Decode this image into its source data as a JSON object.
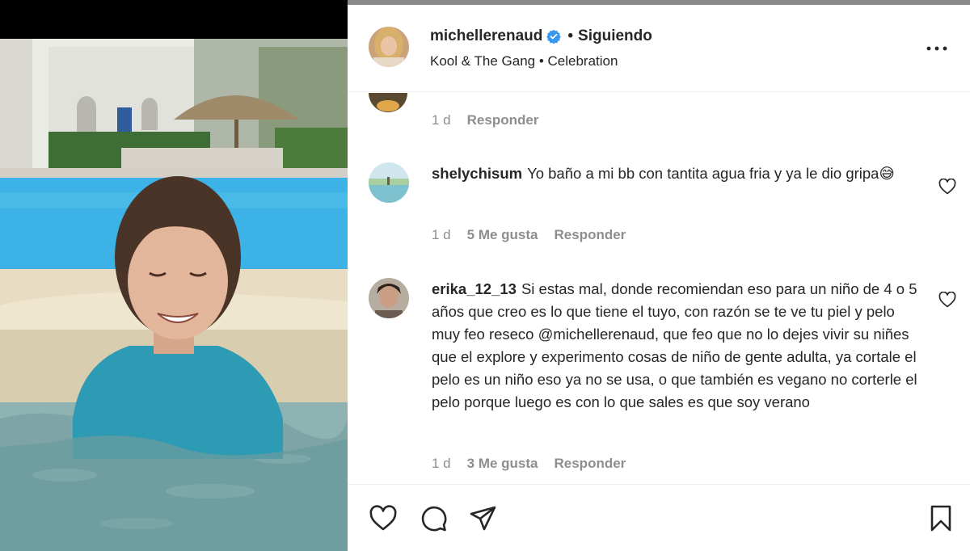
{
  "post": {
    "author": "michellerenaud",
    "follow_status": "Siguiendo",
    "separator": "•",
    "music": "Kool & The Gang • Celebration"
  },
  "icons": {
    "verified": "verified-badge-icon",
    "more": "more-options-icon",
    "like": "heart-icon",
    "comment": "comment-bubble-icon",
    "share": "paper-plane-icon",
    "save": "bookmark-icon"
  },
  "colors": {
    "verified_blue": "#3897f0",
    "text": "#262626",
    "secondary": "#8e8e8e",
    "pool": "#3cb2e6"
  },
  "prev_comment": {
    "time": "1 d",
    "reply_label": "Responder"
  },
  "comments": [
    {
      "username": "shelychisum",
      "text": "Yo baño a mi bb con tantita agua fria y ya le dio gripa😅",
      "time": "1 d",
      "likes": "5 Me gusta",
      "reply_label": "Responder"
    },
    {
      "username": "erika_12_13",
      "text": "Si estas mal, donde recomiendan eso para un niño de 4 o 5 años que creo es lo que tiene el tuyo, con razón se te ve tu piel y pelo muy feo reseco @michellerenaud, que feo que no lo dejes vivir su niñes que el explore y experimento cosas de niño de gente adulta, ya cortale el pelo es un niño eso ya no se usa, o que también es vegano no corterle el pelo porque luego es con lo que sales es que soy verano",
      "time": "1 d",
      "likes": "3 Me gusta",
      "reply_label": "Responder"
    }
  ]
}
